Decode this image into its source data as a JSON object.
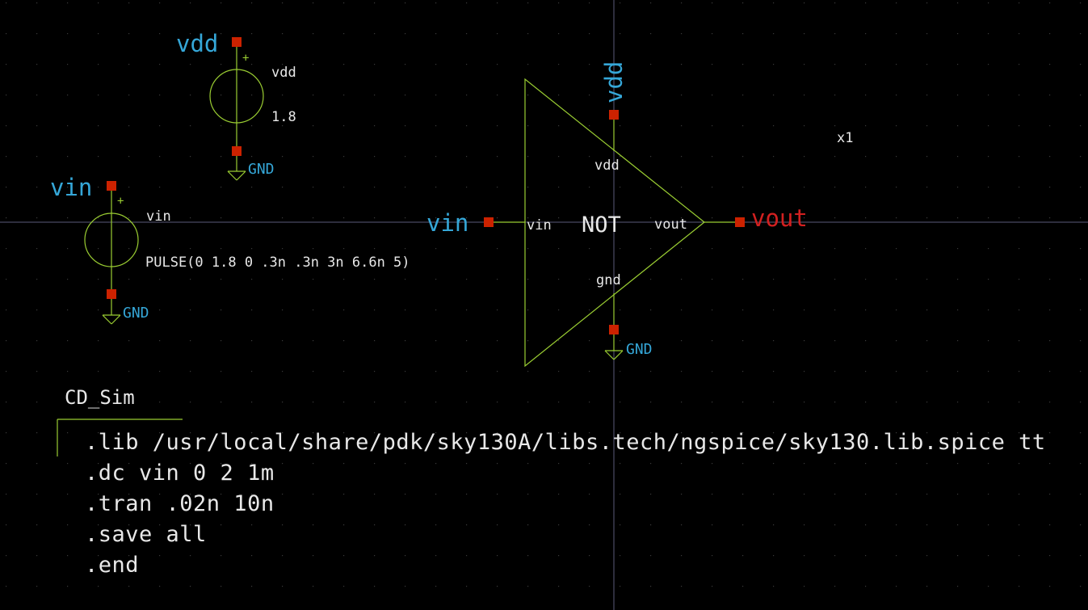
{
  "window": {
    "app": "xschem",
    "background": "#000000"
  },
  "colors": {
    "wire": "#9acd32",
    "pin": "#cc2200",
    "net_label": "#35a7d8",
    "output_label": "#d22020",
    "text": "#e8e8e8",
    "grid_dot": "#3a3a3a",
    "crosshair": "#5a5a7a"
  },
  "vdd_source": {
    "net_name": "vdd",
    "instance_name": "vdd",
    "value": "1.8",
    "plus_sign": "+",
    "gnd_label": "GND"
  },
  "vin_source": {
    "net_name": "vin",
    "instance_name": "vin",
    "value": "PULSE(0 1.8 0 .3n .3n 3n 6.6n 5)",
    "plus_sign": "+",
    "gnd_label": "GND"
  },
  "inverter": {
    "title": "NOT",
    "instance": "x1",
    "pins": {
      "in": "vin",
      "out": "vout",
      "vdd": "vdd",
      "gnd": "gnd"
    },
    "net_in": "vin",
    "net_out": "vout",
    "net_vdd": "vdd",
    "gnd_label": "GND"
  },
  "code_block": {
    "title": "CD_Sim",
    "lines": [
      ".lib /usr/local/share/pdk/sky130A/libs.tech/ngspice/sky130.lib.spice tt",
      ".dc vin 0 2 1m",
      ".tran .02n 10n",
      ".save all",
      ".end"
    ]
  }
}
